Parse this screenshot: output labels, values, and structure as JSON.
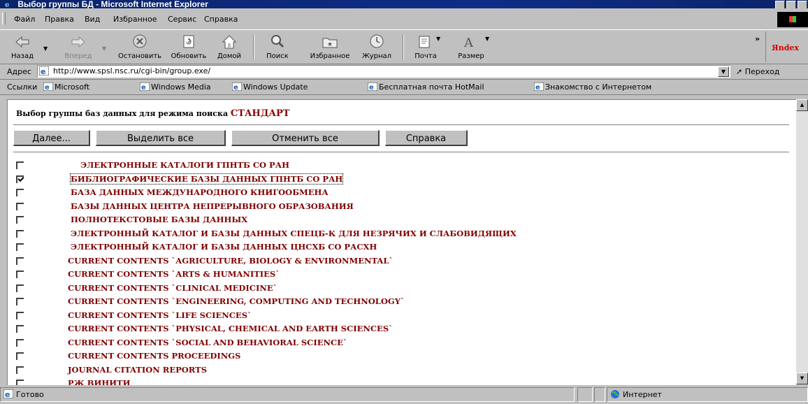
{
  "window": {
    "title": "Выбор группы БД - Microsoft Internet Explorer"
  },
  "menu": [
    {
      "label": "Файл"
    },
    {
      "label": "Правка"
    },
    {
      "label": "Вид"
    },
    {
      "label": "Избранное"
    },
    {
      "label": "Сервис"
    },
    {
      "label": "Справка"
    }
  ],
  "toolbar": {
    "back": "Назад",
    "forward": "Вперед",
    "stop": "Остановить",
    "refresh": "Обновить",
    "home": "Домой",
    "search": "Поиск",
    "favorites": "Избранное",
    "history": "Журнал",
    "mail": "Почта",
    "size": "Размер",
    "more": "»",
    "yandex": "Яndex"
  },
  "address": {
    "label": "Адрес",
    "url": "http://www.spsl.nsc.ru/cgi-bin/group.exe/",
    "go": "Переход"
  },
  "links": {
    "label": "Ссылки",
    "items": [
      "Microsoft",
      "Windows Media",
      "Windows Update",
      "Бесплатная почта HotMail",
      "Знакомство с Интернетом"
    ]
  },
  "page": {
    "title_prefix": "Выбор группы баз данных для режима поиска",
    "mode": "СТАНДАРТ",
    "buttons": {
      "next": "Далее...",
      "select_all": "Выделить все",
      "deselect_all": "Отменить все",
      "help": "Справка"
    },
    "databases": [
      {
        "label": "ЭЛЕКТРОННЫЕ КАТАЛОГИ ГПНТБ СО РАН",
        "checked": false
      },
      {
        "label": "БИБЛИОГРАФИЧЕСКИЕ БАЗЫ ДАННЫХ ГПНТБ СО РАН",
        "checked": true
      },
      {
        "label": "БАЗА ДАННЫХ МЕЖДУНАРОДНОГО КНИГООБМЕНА",
        "checked": false
      },
      {
        "label": "БАЗЫ ДАННЫХ ЦЕНТРА НЕПРЕРЫВНОГО ОБРАЗОВАНИЯ",
        "checked": false
      },
      {
        "label": "ПОЛНОТЕКСТОВЫЕ БАЗЫ ДАННЫХ",
        "checked": false
      },
      {
        "label": "ЭЛЕКТРОННЫЙ КАТАЛОГ И БАЗЫ ДАННЫХ СПЕЦБ-К ДЛЯ НЕЗРЯЧИХ И СЛАБОВИДЯЩИХ",
        "checked": false
      },
      {
        "label": "ЭЛЕКТРОННЫЙ КАТАЛОГ И БАЗЫ ДАННЫХ ЦНСХБ СО РАСХН",
        "checked": false
      },
      {
        "label": "CURRENT CONTENTS `AGRICULTURE, BIOLOGY & ENVIRONMENTAL`",
        "checked": false
      },
      {
        "label": "CURRENT CONTENTS `ARTS & HUMANITIES`",
        "checked": false
      },
      {
        "label": "CURRENT CONTENTS `CLINICAL MEDICINE`",
        "checked": false
      },
      {
        "label": "CURRENT CONTENTS `ENGINEERING, COMPUTING AND TECHNOLOGY`",
        "checked": false
      },
      {
        "label": "CURRENT CONTENTS `LIFE SCIENCES`",
        "checked": false
      },
      {
        "label": "CURRENT CONTENTS `PHYSICAL, CHEMICAL AND EARTH SCIENCES`",
        "checked": false
      },
      {
        "label": "CURRENT CONTENTS `SOCIAL AND BEHAVIORAL SCIENCE`",
        "checked": false
      },
      {
        "label": "CURRENT CONTENTS PROCEEDINGS",
        "checked": false
      },
      {
        "label": "JOURNAL CITATION REPORTS",
        "checked": false
      },
      {
        "label": "РЖ ВИНИТИ",
        "checked": false
      }
    ]
  },
  "status": {
    "text": "Готово",
    "zone": "Интернет"
  },
  "colors": {
    "title_bar": "#0a246a",
    "link_text": "#800000",
    "chrome": "#c0c0c0"
  }
}
